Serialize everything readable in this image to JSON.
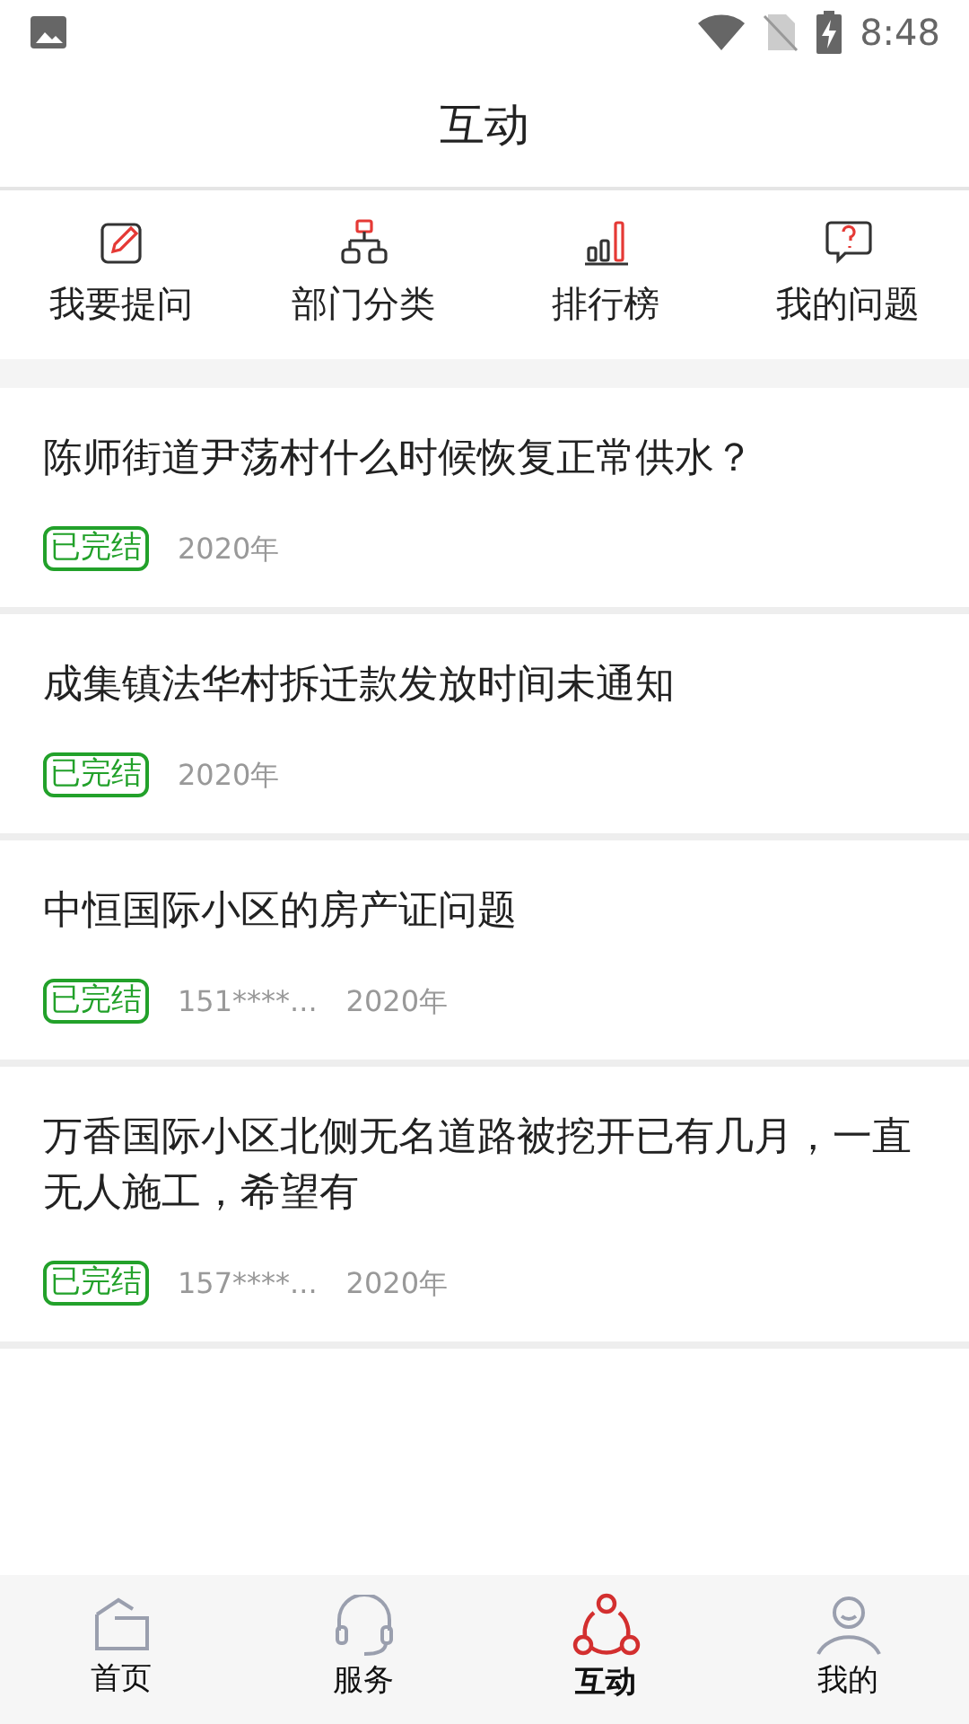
{
  "status_bar": {
    "time": "8:48"
  },
  "header": {
    "title": "互动"
  },
  "shortcuts": [
    {
      "kind": "ask",
      "label": "我要提问"
    },
    {
      "kind": "dept",
      "label": "部门分类"
    },
    {
      "kind": "rank",
      "label": "排行榜"
    },
    {
      "kind": "mine",
      "label": "我的问题"
    }
  ],
  "questions": [
    {
      "title": "陈师街道尹荡村什么时候恢复正常供水？",
      "status": "已完结",
      "date": "2020年"
    },
    {
      "title": "成集镇法华村拆迁款发放时间未通知",
      "status": "已完结",
      "date": "2020年"
    },
    {
      "title": "中恒国际小区的房产证问题",
      "status": "已完结",
      "user": "151****...",
      "date": "2020年"
    },
    {
      "title": "万香国际小区北侧无名道路被挖开已有几月，一直无人施工，希望有",
      "status": "已完结",
      "user": "157****...",
      "date": "2020年"
    }
  ],
  "tab_bar": [
    {
      "kind": "home",
      "label": "首页",
      "selected": false
    },
    {
      "kind": "service",
      "label": "服务",
      "selected": false
    },
    {
      "kind": "interact",
      "label": "互动",
      "selected": true
    },
    {
      "kind": "me",
      "label": "我的",
      "selected": false
    }
  ]
}
